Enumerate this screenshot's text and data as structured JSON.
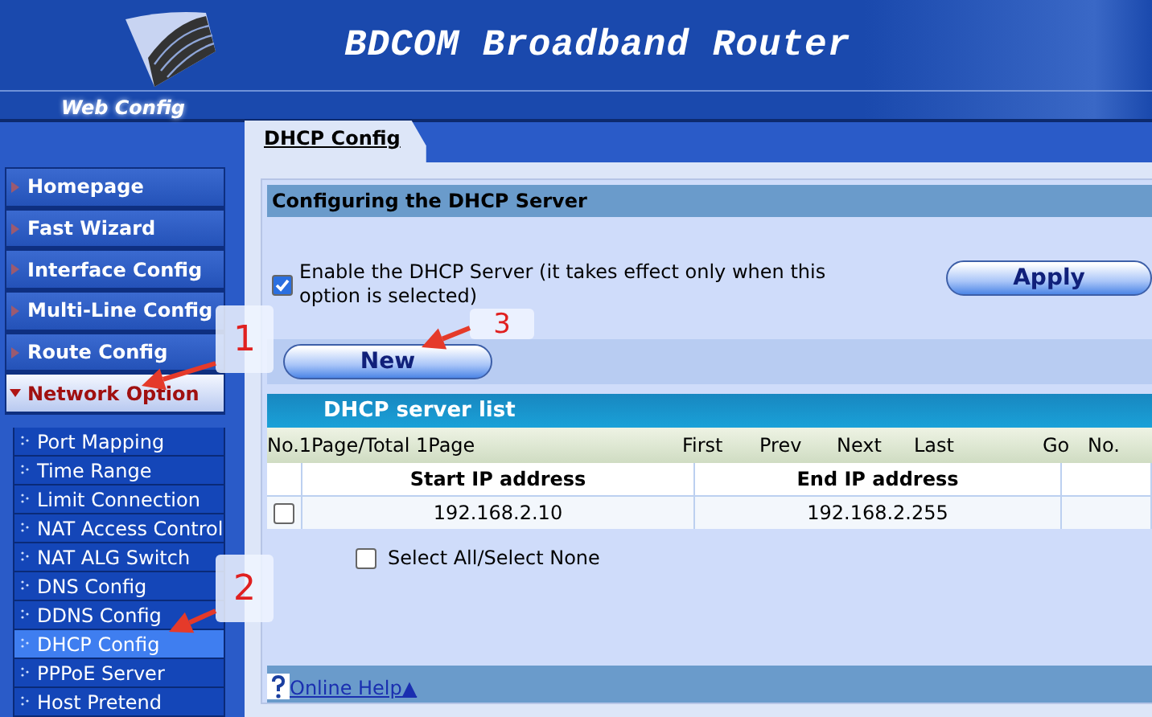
{
  "header": {
    "title": "BDCOM Broadband Router",
    "subtitle": "Web Config"
  },
  "sidebar": {
    "items": [
      {
        "label": "Homepage",
        "expanded": false
      },
      {
        "label": "Fast Wizard",
        "expanded": false
      },
      {
        "label": "Interface Config",
        "expanded": false
      },
      {
        "label": "Multi-Line Config",
        "expanded": false
      },
      {
        "label": "Route Config",
        "expanded": false
      },
      {
        "label": "Network Option",
        "expanded": true,
        "children": [
          {
            "label": "Port Mapping",
            "selected": false
          },
          {
            "label": "Time Range",
            "selected": false
          },
          {
            "label": "Limit Connection",
            "selected": false
          },
          {
            "label": "NAT Access Control",
            "selected": false
          },
          {
            "label": "NAT ALG Switch",
            "selected": false
          },
          {
            "label": "DNS Config",
            "selected": false
          },
          {
            "label": "DDNS Config",
            "selected": false
          },
          {
            "label": "DHCP Config",
            "selected": true
          },
          {
            "label": "PPPoE Server",
            "selected": false
          },
          {
            "label": "Host Pretend",
            "selected": false
          }
        ]
      }
    ]
  },
  "tabs": [
    {
      "label": "DHCP Config",
      "selected": true
    }
  ],
  "panel": {
    "title": "Configuring the DHCP Server",
    "enable": {
      "label": "Enable the DHCP Server (it takes effect only when this option is selected)",
      "checked": true
    },
    "apply_button": "Apply",
    "new_button": "New",
    "list": {
      "title": "DHCP server list",
      "pager": {
        "status": "No.1Page/Total 1Page",
        "links": [
          "First",
          "Prev",
          "Next",
          "Last"
        ],
        "go": "Go",
        "page_label": "No."
      },
      "columns": [
        "Start IP address",
        "End IP address"
      ],
      "rows": [
        {
          "checked": false,
          "cells": [
            "192.168.2.10",
            "192.168.2.255"
          ]
        }
      ],
      "select_all": {
        "label": "Select All/Select None",
        "checked": false
      }
    },
    "help_link": "Online Help▲"
  },
  "callouts": [
    {
      "label": "1"
    },
    {
      "label": "2"
    },
    {
      "label": "3"
    }
  ]
}
